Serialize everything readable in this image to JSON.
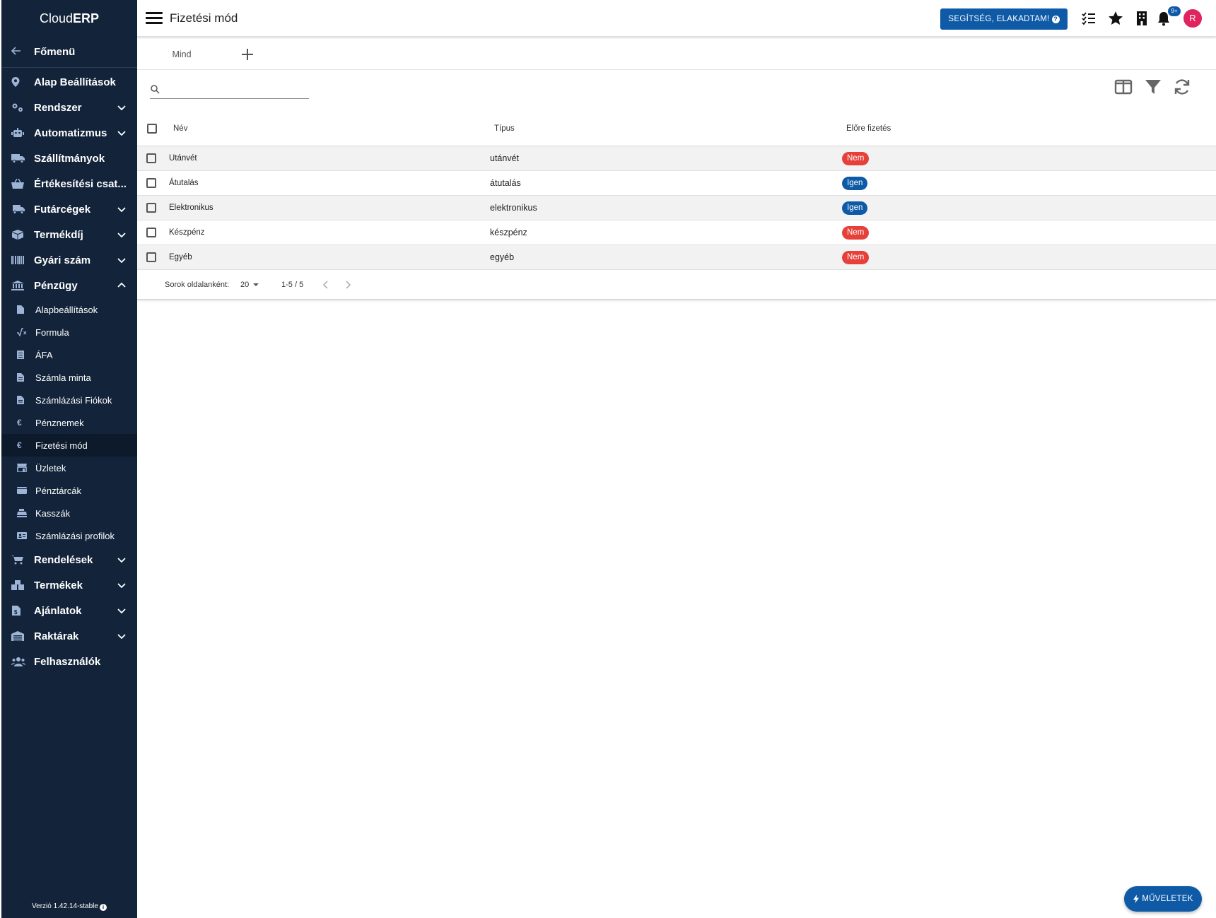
{
  "brand": {
    "prefix": "Cloud",
    "suffix": "ERP"
  },
  "sidebar": {
    "back": "Főmenü",
    "items_top": [
      {
        "label": "Alap Beállítások",
        "icon": "map-pin-icon",
        "chevron": ""
      },
      {
        "label": "Rendszer",
        "icon": "gears-icon",
        "chevron": "down"
      },
      {
        "label": "Automatizmus",
        "icon": "robot-icon",
        "chevron": "down"
      },
      {
        "label": "Szállítmányok",
        "icon": "truck-icon",
        "chevron": ""
      },
      {
        "label": "Értékesítési csat...",
        "icon": "basket-icon",
        "chevron": ""
      },
      {
        "label": "Futárcégek",
        "icon": "truck-fast-icon",
        "chevron": "down"
      },
      {
        "label": "Termékdíj",
        "icon": "box-icon",
        "chevron": "down"
      },
      {
        "label": "Gyári szám",
        "icon": "barcode-icon",
        "chevron": "down"
      },
      {
        "label": "Pénzügy",
        "icon": "bank-icon",
        "chevron": "up"
      }
    ],
    "sub_items": [
      {
        "label": "Alapbeállítások",
        "icon": "file-icon"
      },
      {
        "label": "Formula",
        "icon": "sqrt-icon"
      },
      {
        "label": "ÁFA",
        "icon": "receipt-icon"
      },
      {
        "label": "Számla minta",
        "icon": "file-text-icon"
      },
      {
        "label": "Számlázási Fiókok",
        "icon": "file-text-icon"
      },
      {
        "label": "Pénznemek",
        "icon": "euro-icon"
      },
      {
        "label": "Fizetési mód",
        "icon": "euro-icon"
      },
      {
        "label": "Üzletek",
        "icon": "store-icon"
      },
      {
        "label": "Pénztárcák",
        "icon": "wallet-icon"
      },
      {
        "label": "Kasszák",
        "icon": "cash-register-icon"
      },
      {
        "label": "Számlázási profilok",
        "icon": "id-card-icon"
      }
    ],
    "items_bottom": [
      {
        "label": "Rendelések",
        "icon": "cart-icon",
        "chevron": "down"
      },
      {
        "label": "Termékek",
        "icon": "boxes-icon",
        "chevron": "down"
      },
      {
        "label": "Ajánlatok",
        "icon": "file-dollar-icon",
        "chevron": "down"
      },
      {
        "label": "Raktárak",
        "icon": "warehouse-icon",
        "chevron": "down"
      },
      {
        "label": "Felhasználók",
        "icon": "users-icon",
        "chevron": ""
      }
    ],
    "version": "Verzió 1.42.14-stable"
  },
  "header": {
    "title": "Fizetési mód",
    "help_label": "SEGÍTSÉG, ELAKADTAM!",
    "notification_badge": "9+",
    "avatar_initial": "R"
  },
  "tabs": {
    "active": "Mind"
  },
  "search": {
    "value": "",
    "placeholder": ""
  },
  "table": {
    "columns": {
      "name": "Név",
      "type": "Típus",
      "prepaid": "Előre fizetés"
    },
    "rows": [
      {
        "name": "Utánvét",
        "type": "utánvét",
        "prepaid": "Nem",
        "prepaid_yes": false
      },
      {
        "name": "Átutalás",
        "type": "átutalás",
        "prepaid": "Igen",
        "prepaid_yes": true
      },
      {
        "name": "Elektronikus",
        "type": "elektronikus",
        "prepaid": "Igen",
        "prepaid_yes": true
      },
      {
        "name": "Készpénz",
        "type": "készpénz",
        "prepaid": "Nem",
        "prepaid_yes": false
      },
      {
        "name": "Egyéb",
        "type": "egyéb",
        "prepaid": "Nem",
        "prepaid_yes": false
      }
    ]
  },
  "pager": {
    "rows_per_page_label": "Sorok oldalanként:",
    "rows_per_page": "20",
    "range": "1-5 / 5"
  },
  "fab": {
    "label": "MŰVELETEK"
  },
  "colors": {
    "sidebar_bg": "#12233a",
    "primary": "#0f5aa6",
    "danger": "#e6403a",
    "avatar": "#e0245e"
  }
}
